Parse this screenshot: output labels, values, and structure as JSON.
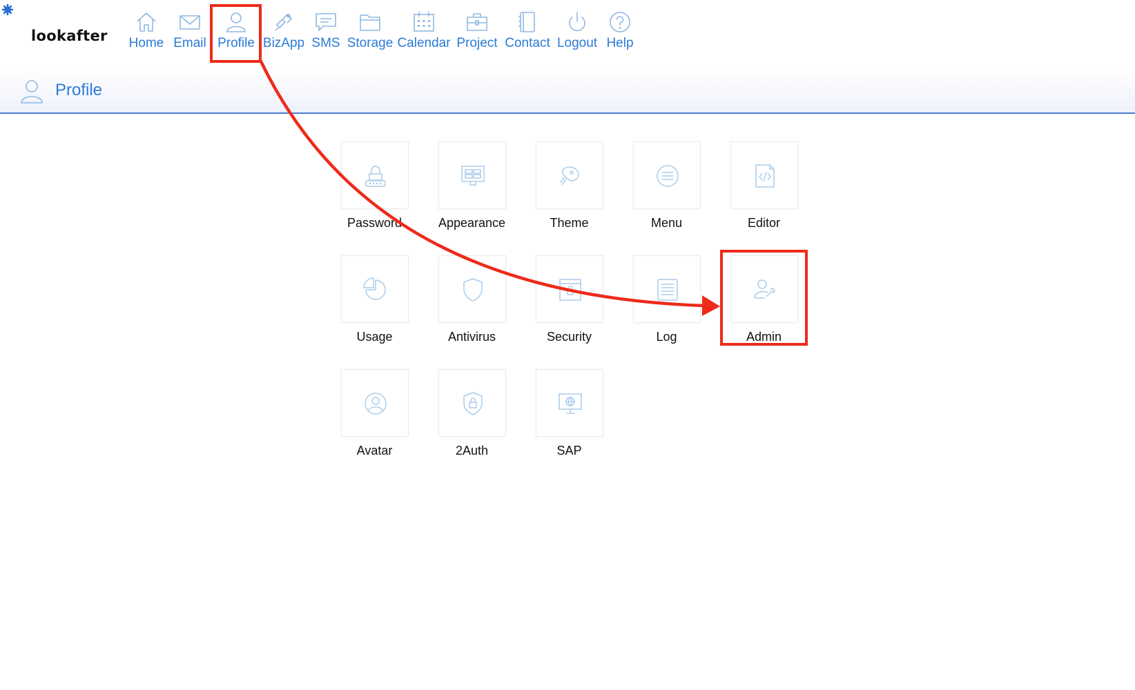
{
  "app": {
    "logo_text": "lookafter"
  },
  "nav": {
    "items": [
      {
        "label": "Home",
        "icon": "home-icon"
      },
      {
        "label": "Email",
        "icon": "email-icon"
      },
      {
        "label": "Profile",
        "icon": "profile-icon"
      },
      {
        "label": "BizApp",
        "icon": "bizapp-icon"
      },
      {
        "label": "SMS",
        "icon": "sms-icon"
      },
      {
        "label": "Storage",
        "icon": "storage-icon"
      },
      {
        "label": "Calendar",
        "icon": "calendar-icon"
      },
      {
        "label": "Project",
        "icon": "project-icon"
      },
      {
        "label": "Contact",
        "icon": "contact-icon"
      },
      {
        "label": "Logout",
        "icon": "logout-icon"
      },
      {
        "label": "Help",
        "icon": "help-icon"
      }
    ],
    "highlighted": "Profile"
  },
  "page": {
    "title": "Profile",
    "icon": "profile-icon"
  },
  "tiles": [
    {
      "label": "Password",
      "icon": "password-icon"
    },
    {
      "label": "Appearance",
      "icon": "appearance-icon"
    },
    {
      "label": "Theme",
      "icon": "theme-icon"
    },
    {
      "label": "Menu",
      "icon": "menu-icon"
    },
    {
      "label": "Editor",
      "icon": "editor-icon"
    },
    {
      "label": "Usage",
      "icon": "usage-icon"
    },
    {
      "label": "Antivirus",
      "icon": "antivirus-icon"
    },
    {
      "label": "Security",
      "icon": "security-icon"
    },
    {
      "label": "Log",
      "icon": "log-icon"
    },
    {
      "label": "Admin",
      "icon": "admin-icon"
    },
    {
      "label": "Avatar",
      "icon": "avatar-icon"
    },
    {
      "label": "2Auth",
      "icon": "2auth-icon"
    },
    {
      "label": "SAP",
      "icon": "sap-icon"
    }
  ],
  "annotation": {
    "highlighted_tile": "Admin",
    "arrow_from": "Profile",
    "arrow_to": "Admin"
  },
  "colors": {
    "link": "#2b7bd6",
    "icon_light": "#a9ccec",
    "annotation": "#ee2a1a",
    "header_rule": "#4a7ad0"
  }
}
